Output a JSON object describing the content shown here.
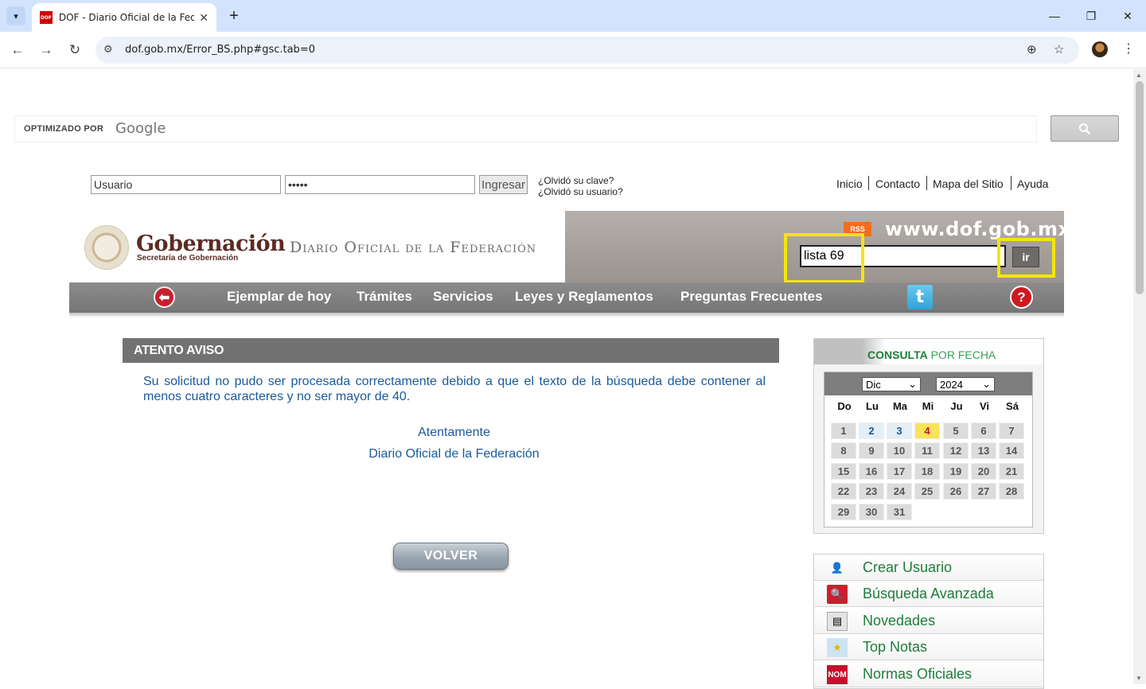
{
  "browser": {
    "tab_title": "DOF - Diario Oficial de la Federación",
    "favicon_text": "DOF",
    "url": "dof.gob.mx/Error_BS.php#gsc.tab=0"
  },
  "google_search": {
    "powered_by": "OPTIMIZADO POR",
    "brand": "Google",
    "search_icon": "search-icon"
  },
  "login": {
    "user_value": "Usuario",
    "password_value": "•••••",
    "submit_label": "Ingresar",
    "forgot_password": "¿Olvidó su clave?",
    "forgot_user": "¿Olvidó su usuario?"
  },
  "top_links": [
    "Inicio",
    "Contacto",
    "Mapa del Sitio",
    "Ayuda"
  ],
  "header": {
    "gob_title": "Gobernación",
    "gob_subtitle": "Secretaría de Gobernación",
    "dof_title": "Diario Oficial de la Federación",
    "rss_label": "RSS",
    "site_url": "www.dof.gob.mx",
    "search_value": "lista 69",
    "search_button": "ir",
    "highlight_color": "#f5e40c"
  },
  "nav": {
    "items": [
      "Ejemplar de hoy",
      "Trámites",
      "Servicios",
      "Leyes y Reglamentos",
      "Preguntas Frecuentes"
    ],
    "twitter_glyph": "t",
    "help_glyph": "?"
  },
  "notice": {
    "title": "ATENTO AVISO",
    "message": "Su solicitud no pudo ser procesada correctamente debido a que el texto de la búsqueda debe contener al menos cuatro caracteres y no ser mayor de 40.",
    "closing": "Atentamente",
    "signature": "Diario Oficial de la Federación",
    "back_button": "VOLVER"
  },
  "calendar": {
    "title_bold": "CONSULTA",
    "title_light": "POR FECHA",
    "month": "Dic",
    "year": "2024",
    "weekdays": [
      "Do",
      "Lu",
      "Ma",
      "Mi",
      "Ju",
      "Vi",
      "Sá"
    ],
    "days": [
      "1",
      "2",
      "3",
      "4",
      "5",
      "6",
      "7",
      "8",
      "9",
      "10",
      "11",
      "12",
      "13",
      "14",
      "15",
      "16",
      "17",
      "18",
      "19",
      "20",
      "21",
      "22",
      "23",
      "24",
      "25",
      "26",
      "27",
      "28",
      "29",
      "30",
      "31"
    ],
    "today": "4",
    "linked_days": [
      "2",
      "3"
    ]
  },
  "side_links": [
    {
      "label": "Crear Usuario",
      "icon": "add-user-icon"
    },
    {
      "label": "Búsqueda Avanzada",
      "icon": "search-icon"
    },
    {
      "label": "Novedades",
      "icon": "news-icon"
    },
    {
      "label": "Top Notas",
      "icon": "star-icon"
    },
    {
      "label": "Normas Oficiales",
      "icon": "nom-icon",
      "icon_text": "NOM"
    }
  ]
}
